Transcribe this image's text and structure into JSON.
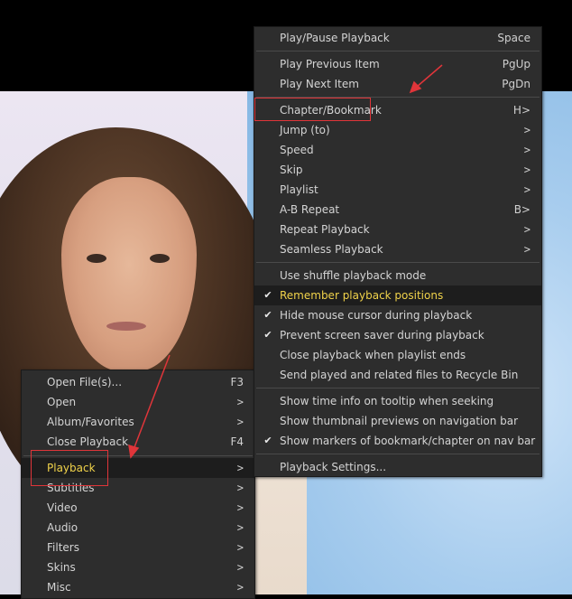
{
  "main_menu": {
    "items": [
      {
        "label": "Open File(s)...",
        "shortcut": "F3",
        "submenu": false
      },
      {
        "label": "Open",
        "shortcut": "",
        "submenu": true
      },
      {
        "label": "Album/Favorites",
        "shortcut": "",
        "submenu": true
      },
      {
        "label": "Close Playback",
        "shortcut": "F4",
        "submenu": false
      },
      {
        "label": "Playback",
        "shortcut": "",
        "submenu": true,
        "highlighted": true
      },
      {
        "label": "Subtitles",
        "shortcut": "",
        "submenu": true
      },
      {
        "label": "Video",
        "shortcut": "",
        "submenu": true
      },
      {
        "label": "Audio",
        "shortcut": "",
        "submenu": true
      },
      {
        "label": "Filters",
        "shortcut": "",
        "submenu": true
      },
      {
        "label": "Skins",
        "shortcut": "",
        "submenu": true
      },
      {
        "label": "Misc",
        "shortcut": "",
        "submenu": true
      }
    ]
  },
  "playback_menu": {
    "items": [
      {
        "label": "Play/Pause Playback",
        "shortcut": "Space"
      },
      {
        "label": "Play Previous Item",
        "shortcut": "PgUp"
      },
      {
        "label": "Play Next Item",
        "shortcut": "PgDn"
      },
      {
        "label": "Chapter/Bookmark",
        "shortcut": "H>"
      },
      {
        "label": "Jump (to)",
        "shortcut": ">"
      },
      {
        "label": "Speed",
        "shortcut": ">"
      },
      {
        "label": "Skip",
        "shortcut": ">"
      },
      {
        "label": "Playlist",
        "shortcut": ">"
      },
      {
        "label": "A-B Repeat",
        "shortcut": "B>"
      },
      {
        "label": "Repeat Playback",
        "shortcut": ">"
      },
      {
        "label": "Seamless Playback",
        "shortcut": ">"
      },
      {
        "label": "Use shuffle playback mode",
        "checked": false
      },
      {
        "label": "Remember playback positions",
        "checked": true,
        "highlighted": true
      },
      {
        "label": "Hide mouse cursor during playback",
        "checked": true
      },
      {
        "label": "Prevent screen saver during playback",
        "checked": true
      },
      {
        "label": "Close playback when playlist ends",
        "checked": false
      },
      {
        "label": "Send played and related files to Recycle Bin",
        "checked": false
      },
      {
        "label": "Show time info on tooltip when seeking",
        "checked": false
      },
      {
        "label": "Show thumbnail previews on navigation bar",
        "checked": false
      },
      {
        "label": "Show markers of bookmark/chapter on nav bar",
        "checked": true
      },
      {
        "label": "Playback Settings...",
        "checked": false
      }
    ]
  },
  "glyphs": {
    "arrow": ">",
    "check": "✔"
  },
  "colors": {
    "highlight_text": "#f0d24a",
    "annotation": "#e0353a",
    "menu_bg": "#2d2d2d"
  }
}
